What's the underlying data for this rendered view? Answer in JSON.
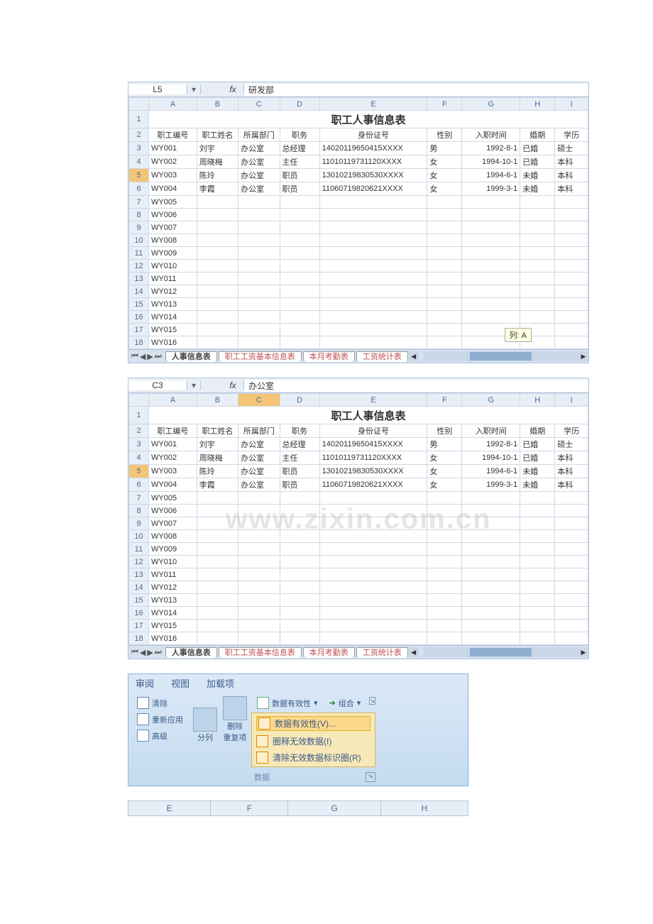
{
  "panel1": {
    "namebox": "L5",
    "fx": "fx",
    "formula": "研发部",
    "cols": [
      "A",
      "B",
      "C",
      "D",
      "E",
      "F",
      "G",
      "H",
      "I"
    ],
    "title": "职工人事信息表",
    "headers": [
      "职工编号",
      "职工姓名",
      "所属部门",
      "职务",
      "身份证号",
      "性别",
      "入职时间",
      "婚期",
      "学历"
    ],
    "rows": [
      [
        "WY001",
        "刘宇",
        "办公室",
        "总经理",
        "14020119650415XXXX",
        "男",
        "1992-8-1",
        "已婚",
        "硕士"
      ],
      [
        "WY002",
        "周晓梅",
        "办公室",
        "主任",
        "11010119731120XXXX",
        "女",
        "1994-10-1",
        "已婚",
        "本科"
      ],
      [
        "WY003",
        "陈玲",
        "办公室",
        "职员",
        "13010219830530XXXX",
        "女",
        "1994-6-1",
        "未婚",
        "本科"
      ],
      [
        "WY004",
        "李霞",
        "办公室",
        "职员",
        "11060719820621XXXX",
        "女",
        "1999-3-1",
        "未婚",
        "本科"
      ],
      [
        "WY005",
        "",
        "",
        "",
        "",
        "",
        "",
        "",
        ""
      ],
      [
        "WY006",
        "",
        "",
        "",
        "",
        "",
        "",
        "",
        ""
      ],
      [
        "WY007",
        "",
        "",
        "",
        "",
        "",
        "",
        "",
        ""
      ],
      [
        "WY008",
        "",
        "",
        "",
        "",
        "",
        "",
        "",
        ""
      ],
      [
        "WY009",
        "",
        "",
        "",
        "",
        "",
        "",
        "",
        ""
      ],
      [
        "WY010",
        "",
        "",
        "",
        "",
        "",
        "",
        "",
        ""
      ],
      [
        "WY011",
        "",
        "",
        "",
        "",
        "",
        "",
        "",
        ""
      ],
      [
        "WY012",
        "",
        "",
        "",
        "",
        "",
        "",
        "",
        ""
      ],
      [
        "WY013",
        "",
        "",
        "",
        "",
        "",
        "",
        "",
        ""
      ],
      [
        "WY014",
        "",
        "",
        "",
        "",
        "",
        "",
        "",
        ""
      ],
      [
        "WY015",
        "",
        "",
        "",
        "",
        "",
        "",
        "",
        ""
      ],
      [
        "WY016",
        "",
        "",
        "",
        "",
        "",
        "",
        "",
        ""
      ]
    ],
    "tooltip": "列: A",
    "tabs": [
      "人事信息表",
      "职工工资基本信息表",
      "本月考勤表",
      "工资统计表"
    ],
    "active_tab": 0
  },
  "panel2": {
    "namebox": "C3",
    "fx": "fx",
    "formula": "办公室",
    "cols": [
      "A",
      "B",
      "C",
      "D",
      "E",
      "F",
      "G",
      "H",
      "I"
    ],
    "title": "职工人事信息表",
    "headers": [
      "职工编号",
      "职工姓名",
      "所属部门",
      "职务",
      "身份证号",
      "性别",
      "入职时间",
      "婚期",
      "学历"
    ],
    "sel_col": "C",
    "rows": [
      [
        "WY001",
        "刘宇",
        "办公室",
        "总经理",
        "14020119650415XXXX",
        "男",
        "1992-8-1",
        "已婚",
        "硕士"
      ],
      [
        "WY002",
        "周晓梅",
        "办公室",
        "主任",
        "11010119731120XXXX",
        "女",
        "1994-10-1",
        "已婚",
        "本科"
      ],
      [
        "WY003",
        "陈玲",
        "办公室",
        "职员",
        "13010219830530XXXX",
        "女",
        "1994-6-1",
        "未婚",
        "本科"
      ],
      [
        "WY004",
        "李霞",
        "办公室",
        "职员",
        "11060719820621XXXX",
        "女",
        "1999-3-1",
        "未婚",
        "本科"
      ],
      [
        "WY005",
        "",
        "",
        "",
        "",
        "",
        "",
        "",
        ""
      ],
      [
        "WY006",
        "",
        "",
        "",
        "",
        "",
        "",
        "",
        ""
      ],
      [
        "WY007",
        "",
        "",
        "",
        "",
        "",
        "",
        "",
        ""
      ],
      [
        "WY008",
        "",
        "",
        "",
        "",
        "",
        "",
        "",
        ""
      ],
      [
        "WY009",
        "",
        "",
        "",
        "",
        "",
        "",
        "",
        ""
      ],
      [
        "WY010",
        "",
        "",
        "",
        "",
        "",
        "",
        "",
        ""
      ],
      [
        "WY011",
        "",
        "",
        "",
        "",
        "",
        "",
        "",
        ""
      ],
      [
        "WY012",
        "",
        "",
        "",
        "",
        "",
        "",
        "",
        ""
      ],
      [
        "WY013",
        "",
        "",
        "",
        "",
        "",
        "",
        "",
        ""
      ],
      [
        "WY014",
        "",
        "",
        "",
        "",
        "",
        "",
        "",
        ""
      ],
      [
        "WY015",
        "",
        "",
        "",
        "",
        "",
        "",
        "",
        ""
      ],
      [
        "WY016",
        "",
        "",
        "",
        "",
        "",
        "",
        "",
        ""
      ]
    ],
    "watermark": "www.zixin.com.cn",
    "tabs": [
      "人事信息表",
      "职工工资基本信息表",
      "本月考勤表",
      "工资统计表"
    ],
    "active_tab": 0
  },
  "ribbon": {
    "tabs": [
      "审阅",
      "视图",
      "加载项"
    ],
    "left_group": [
      "清除",
      "重新应用",
      "高级"
    ],
    "mid_group": [
      "分列",
      "删除\n重复项"
    ],
    "dv_button": "数据有效性",
    "group_btn": "组合",
    "menu": [
      {
        "label": "数据有效性(V)...",
        "hl": true
      },
      {
        "label": "圈释无效数据(I)",
        "hl": false
      },
      {
        "label": "清除无效数据标识圈(R)",
        "hl": false
      }
    ],
    "footer_label": "数据"
  },
  "bottom_cols": [
    "E",
    "F",
    "G",
    "H"
  ]
}
